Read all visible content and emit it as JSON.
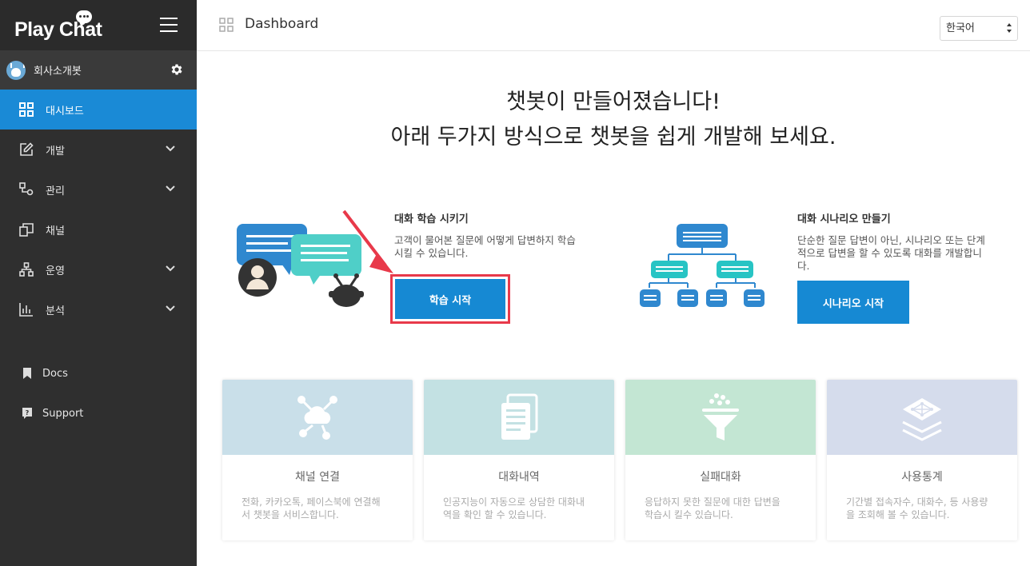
{
  "brand": {
    "name": "Play Chat"
  },
  "sidebar": {
    "bot_name": "회사소개봇",
    "items": [
      {
        "label": "대시보드",
        "icon": "dashboard-icon",
        "active": true
      },
      {
        "label": "개발",
        "icon": "edit-icon",
        "expandable": true
      },
      {
        "label": "관리",
        "icon": "manage-icon",
        "expandable": true
      },
      {
        "label": "채널",
        "icon": "channel-icon"
      },
      {
        "label": "운영",
        "icon": "operation-icon",
        "expandable": true
      },
      {
        "label": "분석",
        "icon": "chart-icon",
        "expandable": true
      }
    ],
    "links": [
      {
        "label": "Docs",
        "icon": "bookmark-icon"
      },
      {
        "label": "Support",
        "icon": "help-icon"
      }
    ]
  },
  "header": {
    "title": "Dashboard",
    "language": "한국어"
  },
  "hero": {
    "line1": "챗봇이 만들어졌습니다!",
    "line2": "아래 두가지 방식으로 챗봇을 쉽게 개발해 보세요."
  },
  "options": {
    "learn": {
      "title": "대화 학습 시키기",
      "desc_line1": "고객이 물어본 질문에 어떻게 답변하지 학습",
      "desc_line2": "시킬 수 있습니다.",
      "button": "학습 시작"
    },
    "scenario": {
      "title": "대화 시나리오 만들기",
      "desc_line1": "단순한 질문 답변이 아닌, 시나리오 또는 단계",
      "desc_line2": "적으로 답변을 할 수 있도록 대화를 개발합니",
      "desc_line3": "다.",
      "button": "시나리오 시작"
    }
  },
  "features": [
    {
      "title": "채널 연결",
      "desc_line1": "전화, 카카오톡, 페이스북에 연결해",
      "desc_line2": "서 챗봇을 서비스합니다.",
      "color": "#c9dfe9",
      "icon": "cloud-network-icon"
    },
    {
      "title": "대화내역",
      "desc_line1": "인공지능이 자동으로 상담한 대화내",
      "desc_line2": "역을 확인 할 수 있습니다.",
      "color": "#c3e1e3",
      "icon": "documents-icon"
    },
    {
      "title": "실패대화",
      "desc_line1": "응답하지 못한 질문에 대한 답변을",
      "desc_line2": "학습시 킬수 있습니다.",
      "color": "#c3e6d3",
      "icon": "funnel-icon"
    },
    {
      "title": "사용통계",
      "desc_line1": "기간별 접속자수, 대화수, 등 사용량",
      "desc_line2": "을 조회해 볼 수 있습니다.",
      "color": "#d5dcec",
      "icon": "layers-icon"
    }
  ],
  "colors": {
    "sidebar_bg": "#2f2f2f",
    "active": "#1a8ad6",
    "button": "#1689d3",
    "highlight": "#e8394a"
  }
}
